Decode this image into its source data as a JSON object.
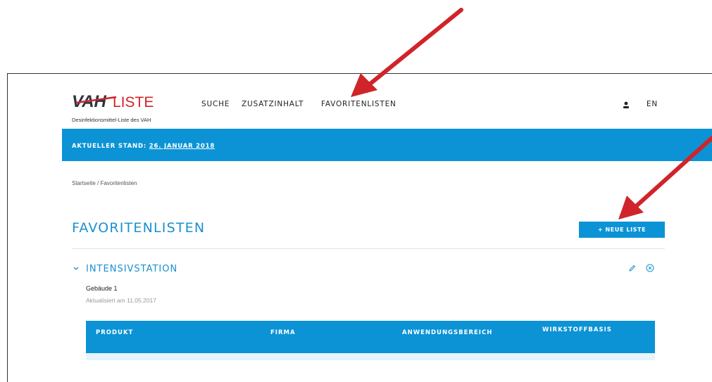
{
  "brand": {
    "logo_text": "VAH LISTE",
    "subtitle": "Desinfektionsmittel-Liste des VAH"
  },
  "nav": {
    "suche": "SUCHE",
    "zusatz": "ZUSATZINHALT",
    "favoriten": "FAVORITENLISTEN",
    "lang": "EN"
  },
  "banner": {
    "label": "AKTUELLER STAND: ",
    "date": "26. JANUAR 2018"
  },
  "breadcrumb": "Startseite / Favoritenlisten",
  "page": {
    "title": "FAVORITENLISTEN",
    "new_button": "+ NEUE LISTE"
  },
  "list": {
    "title": "INTENSIVSTATION",
    "location": "Gebäude 1",
    "updated": "Aktualisiert am 11.05.2017"
  },
  "table": {
    "columns": [
      "PRODUKT",
      "FIRMA",
      "ANWENDUNGSBEREICH",
      "WIRKSTOFFBASIS"
    ]
  },
  "colors": {
    "accent": "#0b93d5",
    "title": "#1a90cf",
    "arrow": "#d0242b"
  },
  "icons": [
    "user-icon",
    "chevron-down-icon",
    "pencil-icon",
    "close-circle-icon"
  ]
}
